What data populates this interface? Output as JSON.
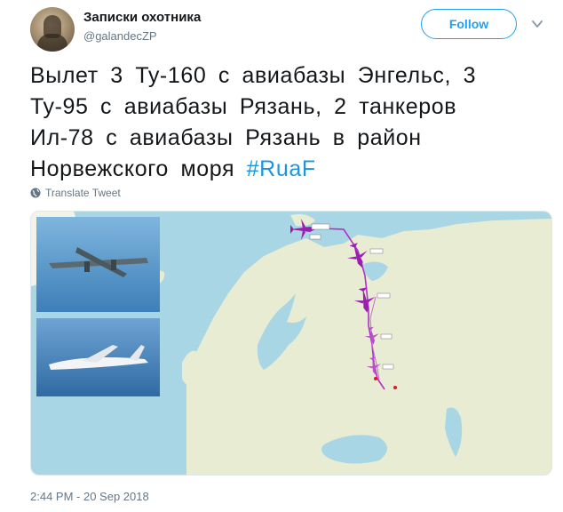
{
  "author": {
    "display_name": "Записки охотника",
    "handle": "@galandecZP"
  },
  "follow_button": {
    "label": "Follow"
  },
  "tweet": {
    "lines": [
      "Вылет 3 Ту-160 с авиабазы Энгельс, 3",
      "Ту-95 с авиабазы Рязань, 2 танкеров",
      "Ил-78 с авиабазы Рязань в район",
      "Норвежского моря "
    ],
    "hashtag": "#RuaF",
    "translate_label": "Translate Tweet",
    "timestamp": "2:44 PM - 20 Sep 2018"
  },
  "icons": {
    "more": "chevron-down-icon",
    "translate": "globe-icon",
    "aircraft": "plane-icon"
  },
  "colors": {
    "accent": "#1da1f2",
    "hashtag": "#1b95e0",
    "flight_track": "#b030c8",
    "land": "#e8ecd2",
    "sea": "#a9d6e4",
    "secondary_text": "#657786"
  }
}
